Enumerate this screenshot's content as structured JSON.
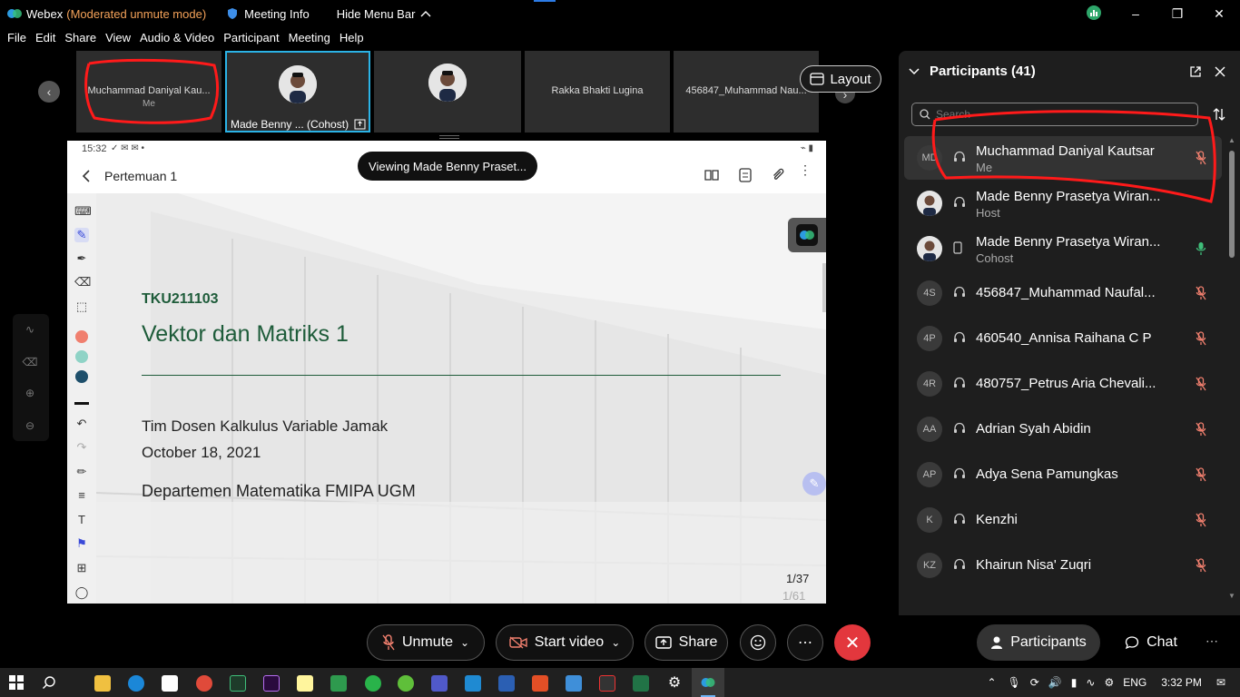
{
  "titlebar": {
    "app_name": "Webex",
    "mode": "(Moderated unmute mode)",
    "meeting_info": "Meeting Info",
    "hide_menu": "Hide Menu Bar"
  },
  "menu": [
    "File",
    "Edit",
    "Share",
    "View",
    "Audio & Video",
    "Participant",
    "Meeting",
    "Help"
  ],
  "strip": {
    "tiles": [
      {
        "name": "Muchammad Daniyal Kau...",
        "sub": "Me"
      },
      {
        "name": "Made Benny ...  (Cohost)"
      },
      {
        "name": ""
      },
      {
        "name": "Rakka Bhakti Lugina"
      },
      {
        "name": "456847_Muhammad Nau..."
      }
    ],
    "layout_label": "Layout"
  },
  "share": {
    "status_time": "15:32",
    "back_title": "Pertemuan 1",
    "viewing_label": "Viewing Made Benny Praset...",
    "page_current": "1/37",
    "page_total": "1/61"
  },
  "slide": {
    "code": "TKU211103",
    "title": "Vektor dan Matriks 1",
    "team": "Tim Dosen Kalkulus Variable Jamak",
    "date": "October 18, 2021",
    "dept": "Departemen Matematika FMIPA UGM"
  },
  "panel": {
    "title": "Participants (41)",
    "search_placeholder": "Search",
    "participants": [
      {
        "initials": "MD",
        "name": "Muchammad Daniyal Kautsar",
        "role": "Me",
        "device": "headset",
        "mic": "muted",
        "photo": false
      },
      {
        "initials": "",
        "name": "Made Benny Prasetya Wiran...",
        "role": "Host",
        "device": "headset",
        "mic": "none",
        "photo": true
      },
      {
        "initials": "",
        "name": "Made Benny Prasetya Wiran...",
        "role": "Cohost",
        "device": "phone",
        "mic": "active",
        "photo": true
      },
      {
        "initials": "4S",
        "name": "456847_Muhammad Naufal...",
        "role": "",
        "device": "headset",
        "mic": "muted",
        "photo": false
      },
      {
        "initials": "4P",
        "name": "460540_Annisa Raihana C P",
        "role": "",
        "device": "headset",
        "mic": "muted",
        "photo": false
      },
      {
        "initials": "4R",
        "name": "480757_Petrus Aria Chevali...",
        "role": "",
        "device": "headset",
        "mic": "muted",
        "photo": false
      },
      {
        "initials": "AA",
        "name": "Adrian Syah Abidin",
        "role": "",
        "device": "headset",
        "mic": "muted",
        "photo": false
      },
      {
        "initials": "AP",
        "name": "Adya Sena Pamungkas",
        "role": "",
        "device": "headset",
        "mic": "muted",
        "photo": false
      },
      {
        "initials": "K",
        "name": "Kenzhi",
        "role": "",
        "device": "headset",
        "mic": "muted",
        "photo": false
      },
      {
        "initials": "KZ",
        "name": "Khairun Nisa' Zuqri",
        "role": "",
        "device": "headset",
        "mic": "muted",
        "photo": false
      }
    ]
  },
  "controls": {
    "unmute": "Unmute",
    "start_video": "Start video",
    "share": "Share",
    "participants": "Participants",
    "chat": "Chat"
  },
  "taskbar": {
    "lang": "ENG",
    "time": "3:32 PM"
  },
  "colors": {
    "accent": "#2bb3e6",
    "annotation_red": "#ff1a1a",
    "slide_green": "#1e5c3a",
    "leave_red": "#e3373d",
    "mode_orange": "#f4a259"
  }
}
